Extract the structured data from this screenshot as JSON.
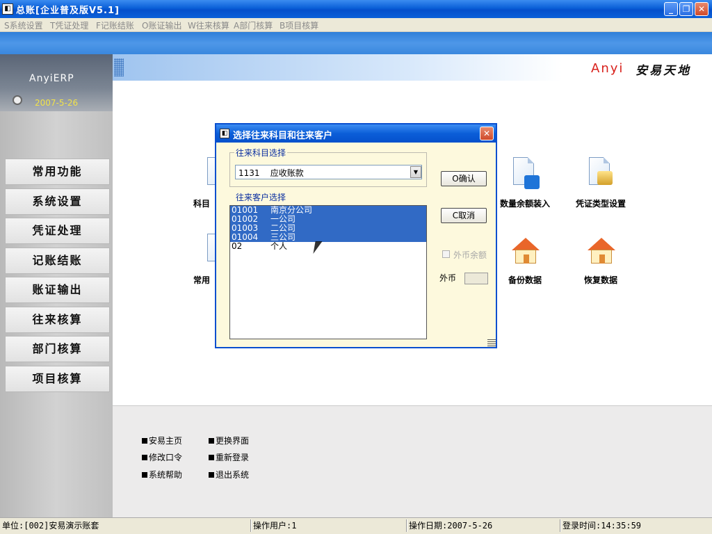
{
  "window": {
    "title": "总账[企业普及版V5.1]"
  },
  "menu": [
    "S系统设置",
    "T凭证处理",
    "F记账结账",
    "O账证输出",
    "W往来核算",
    "A部门核算",
    "B项目核算"
  ],
  "sidebar": {
    "brand": "AnyiERP",
    "date": "2007-5-26",
    "items": [
      "常用功能",
      "系统设置",
      "凭证处理",
      "记账结账",
      "账证输出",
      "往来核算",
      "部门核算",
      "项目核算"
    ]
  },
  "header": {
    "logo_en": "Anyi",
    "logo_cn": "安易天地"
  },
  "features": [
    {
      "label": "科目"
    },
    {
      "label": "数量余额装入"
    },
    {
      "label": "凭证类型设置"
    },
    {
      "label": "常用"
    },
    {
      "label": "备份数据"
    },
    {
      "label": "恢复数据"
    }
  ],
  "bottom_links": [
    "安易主页",
    "更换界面",
    "修改口令",
    "重新登录",
    "系统帮助",
    "退出系统"
  ],
  "status": {
    "unit": "单位:[002]安易演示账套",
    "user": "操作用户:1",
    "date": "操作日期:2007-5-26",
    "login": "登录时间:14:35:59"
  },
  "dialog": {
    "title": "选择往来科目和往来客户",
    "group1_title": "往来科目选择",
    "account_value": "1131    应收账款",
    "group2_title": "往来客户选择",
    "customers": [
      {
        "code": "01001",
        "name": "南京分公司",
        "selected": true
      },
      {
        "code": "01002",
        "name": "一公司",
        "selected": true
      },
      {
        "code": "01003",
        "name": "二公司",
        "selected": true
      },
      {
        "code": "01004",
        "name": "三公司",
        "selected": true
      },
      {
        "code": "02",
        "name": "个人",
        "selected": false
      }
    ],
    "ok_label": "O确认",
    "cancel_label": "C取消",
    "foreign_balance_label": "外币余额",
    "foreign_currency_label": "外币"
  },
  "colors": {
    "titlebar": "#0a5fd8",
    "selection": "#316ac5",
    "dialog_bg": "#fdf9dd",
    "logo_red": "#d8201b"
  }
}
